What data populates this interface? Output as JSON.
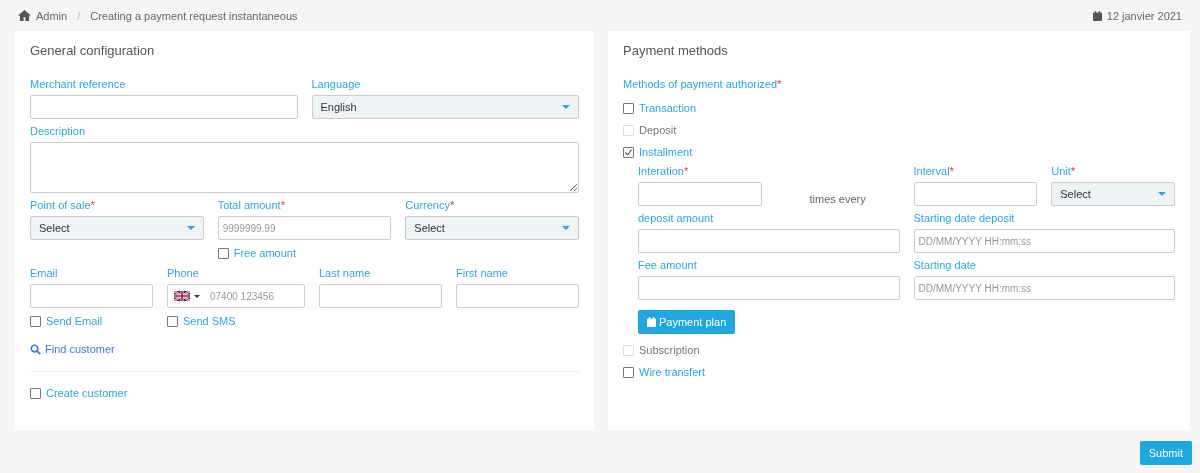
{
  "breadcrumb": {
    "items": [
      "Admin",
      "Creating a payment request instantaneous"
    ],
    "separator": "/"
  },
  "date": "12 janvier 2021",
  "general": {
    "title": "General configuration",
    "rows": [
      {
        "columns": [
          {
            "label": "Merchant reference",
            "kind": "text"
          },
          {
            "label": "Language",
            "kind": "select",
            "value": "English"
          }
        ]
      },
      {
        "columns": [
          {
            "label": "Description",
            "kind": "textarea"
          }
        ]
      },
      {
        "columns": [
          {
            "label": "Point of sale",
            "required_mark": "*",
            "kind": "select",
            "value": "Select"
          },
          {
            "label": "Total amount",
            "required_mark": "*",
            "kind": "text",
            "placeholder": "9999999.99",
            "checkbox": {
              "label": "Free amount",
              "checked": false
            }
          },
          {
            "label": "Currency",
            "required_mark": "*",
            "kind": "select",
            "value": "Select"
          }
        ]
      },
      {
        "columns": [
          {
            "label": "Email",
            "kind": "text",
            "checkbox": {
              "label": "Send Email",
              "checked": false
            }
          },
          {
            "label": "Phone",
            "kind": "phone",
            "placeholder": "07400 123456",
            "checkbox": {
              "label": "Send SMS",
              "checked": false
            }
          },
          {
            "label": "Last name",
            "kind": "text"
          },
          {
            "label": "First name",
            "kind": "text"
          }
        ]
      }
    ],
    "find_link": "Find customer",
    "create_customer": {
      "label": "Create customer",
      "checked": false
    }
  },
  "payment": {
    "title": "Payment methods",
    "methods_label": "Methods of payment authorized",
    "required_mark": "*",
    "methods": [
      {
        "label": "Transaction",
        "checked": false,
        "disabled": false
      },
      {
        "label": "Deposit",
        "checked": false,
        "disabled": true
      },
      {
        "label": "Installment",
        "checked": true,
        "disabled": false,
        "details": {
          "first_row": [
            {
              "label": "Interation",
              "required_mark": "*",
              "kind": "text"
            },
            {
              "kind": "caption",
              "text": "times every"
            },
            {
              "label": "Interval",
              "required_mark": "*",
              "kind": "text"
            },
            {
              "label": "Unit",
              "required_mark": "*",
              "kind": "select",
              "value": "Select"
            }
          ],
          "rows": [
            {
              "columns": [
                {
                  "label": "deposit amount",
                  "kind": "text"
                },
                {
                  "label": "Starting date deposit",
                  "kind": "text",
                  "placeholder": "DD/MM/YYYY HH:mm:ss"
                }
              ]
            },
            {
              "columns": [
                {
                  "label": "Fee amount",
                  "kind": "text"
                },
                {
                  "label": "Starting date",
                  "kind": "text",
                  "placeholder": "DD/MM/YYYY HH:mm:ss"
                }
              ]
            }
          ],
          "plan_button": "Payment plan"
        }
      },
      {
        "label": "Subscription",
        "checked": false,
        "disabled": true
      },
      {
        "label": "Wire transfert",
        "checked": false,
        "disabled": false
      }
    ]
  },
  "submit": "Submit"
}
